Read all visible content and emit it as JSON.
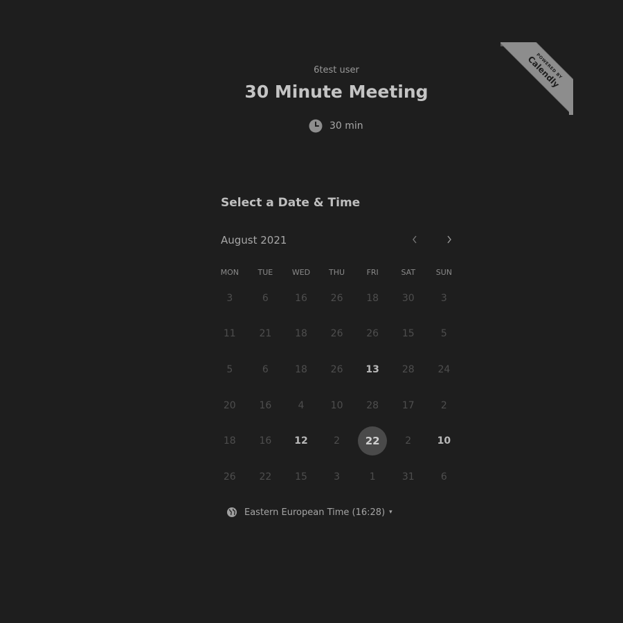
{
  "ribbon": {
    "line1": "POWERED BY",
    "line2": "Calendly"
  },
  "event": {
    "owner": "6test user",
    "title": "30 Minute Meeting",
    "duration": "30 min",
    "duration_icon": "clock-icon"
  },
  "picker": {
    "heading": "Select a Date & Time",
    "month_label": "August 2021",
    "prev_icon": "chevron-left-icon",
    "next_icon": "chevron-right-icon",
    "weekdays": [
      "MON",
      "TUE",
      "WED",
      "THU",
      "FRI",
      "SAT",
      "SUN"
    ],
    "weeks": [
      [
        "3",
        "6",
        "16",
        "26",
        "18",
        "30",
        "3"
      ],
      [
        "11",
        "21",
        "18",
        "26",
        "26",
        "15",
        "5"
      ],
      [
        "5",
        "6",
        "18",
        "26",
        "13",
        "28",
        "24"
      ],
      [
        "20",
        "16",
        "4",
        "10",
        "28",
        "17",
        "2"
      ],
      [
        "18",
        "16",
        "12",
        "2",
        "22",
        "2",
        "10"
      ],
      [
        "26",
        "22",
        "15",
        "3",
        "1",
        "31",
        "6"
      ]
    ],
    "available": [
      [
        2,
        4
      ],
      [
        4,
        2
      ],
      [
        4,
        4
      ],
      [
        4,
        6
      ]
    ],
    "selected": [
      4,
      4
    ]
  },
  "timezone": {
    "label": "Eastern European Time (16:28)",
    "icon": "globe-icon",
    "caret": "▾"
  },
  "colors": {
    "background": "#1e1e1e",
    "ribbon": "#8d8d8d",
    "selected_day": "#4a4a4a"
  }
}
